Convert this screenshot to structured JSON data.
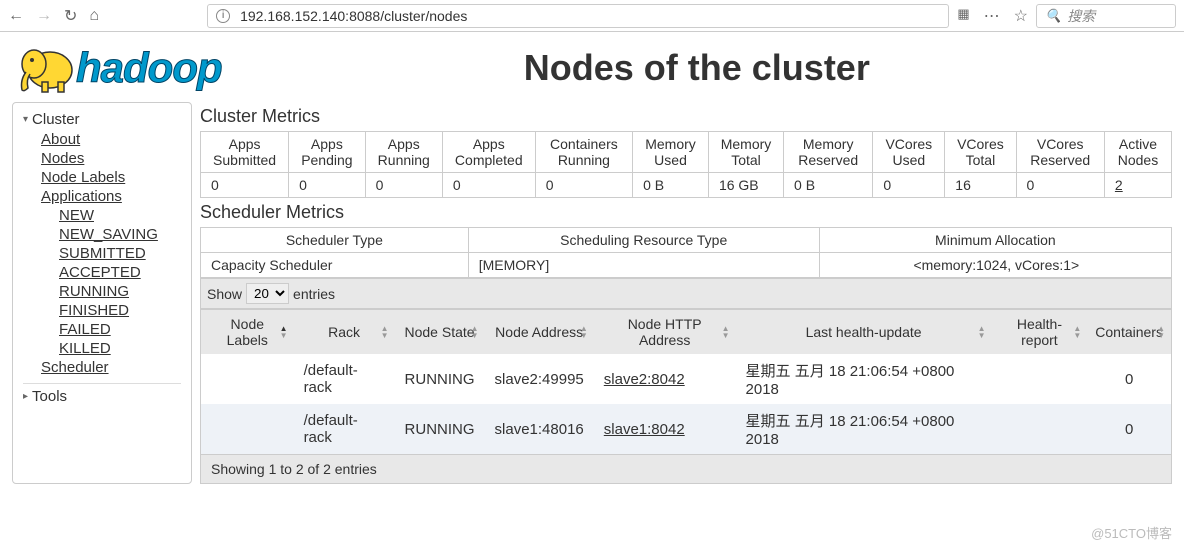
{
  "browser": {
    "url": "192.168.152.140:8088/cluster/nodes",
    "search_placeholder": "搜索"
  },
  "page": {
    "title": "Nodes of the cluster",
    "logo_text": "hadoop"
  },
  "sidebar": {
    "cluster_label": "Cluster",
    "links": {
      "about": "About",
      "nodes": "Nodes",
      "node_labels": "Node Labels",
      "applications": "Applications"
    },
    "app_states": [
      "NEW",
      "NEW_SAVING",
      "SUBMITTED",
      "ACCEPTED",
      "RUNNING",
      "FINISHED",
      "FAILED",
      "KILLED"
    ],
    "scheduler": "Scheduler",
    "tools_label": "Tools"
  },
  "cluster_metrics": {
    "title": "Cluster Metrics",
    "headers": [
      "Apps Submitted",
      "Apps Pending",
      "Apps Running",
      "Apps Completed",
      "Containers Running",
      "Memory Used",
      "Memory Total",
      "Memory Reserved",
      "VCores Used",
      "VCores Total",
      "VCores Reserved",
      "Active Nodes"
    ],
    "values": [
      "0",
      "0",
      "0",
      "0",
      "0",
      "0 B",
      "16 GB",
      "0 B",
      "0",
      "16",
      "0",
      "2"
    ]
  },
  "scheduler_metrics": {
    "title": "Scheduler Metrics",
    "headers": [
      "Scheduler Type",
      "Scheduling Resource Type",
      "Minimum Allocation"
    ],
    "values": [
      "Capacity Scheduler",
      "[MEMORY]",
      "<memory:1024, vCores:1>"
    ]
  },
  "entries_control": {
    "show_label": "Show",
    "entries_label": "entries",
    "page_size": "20"
  },
  "nodes_table": {
    "headers": [
      "Node Labels",
      "Rack",
      "Node State",
      "Node Address",
      "Node HTTP Address",
      "Last health-update",
      "Health-report",
      "Containers"
    ],
    "rows": [
      {
        "labels": "",
        "rack": "/default-rack",
        "state": "RUNNING",
        "address": "slave2:49995",
        "http_address": "slave2:8042",
        "last_update": "星期五 五月 18 21:06:54 +0800 2018",
        "health_report": "",
        "containers": "0"
      },
      {
        "labels": "",
        "rack": "/default-rack",
        "state": "RUNNING",
        "address": "slave1:48016",
        "http_address": "slave1:8042",
        "last_update": "星期五 五月 18 21:06:54 +0800 2018",
        "health_report": "",
        "containers": "0"
      }
    ],
    "footer": "Showing 1 to 2 of 2 entries"
  },
  "watermark": "@51CTO博客"
}
